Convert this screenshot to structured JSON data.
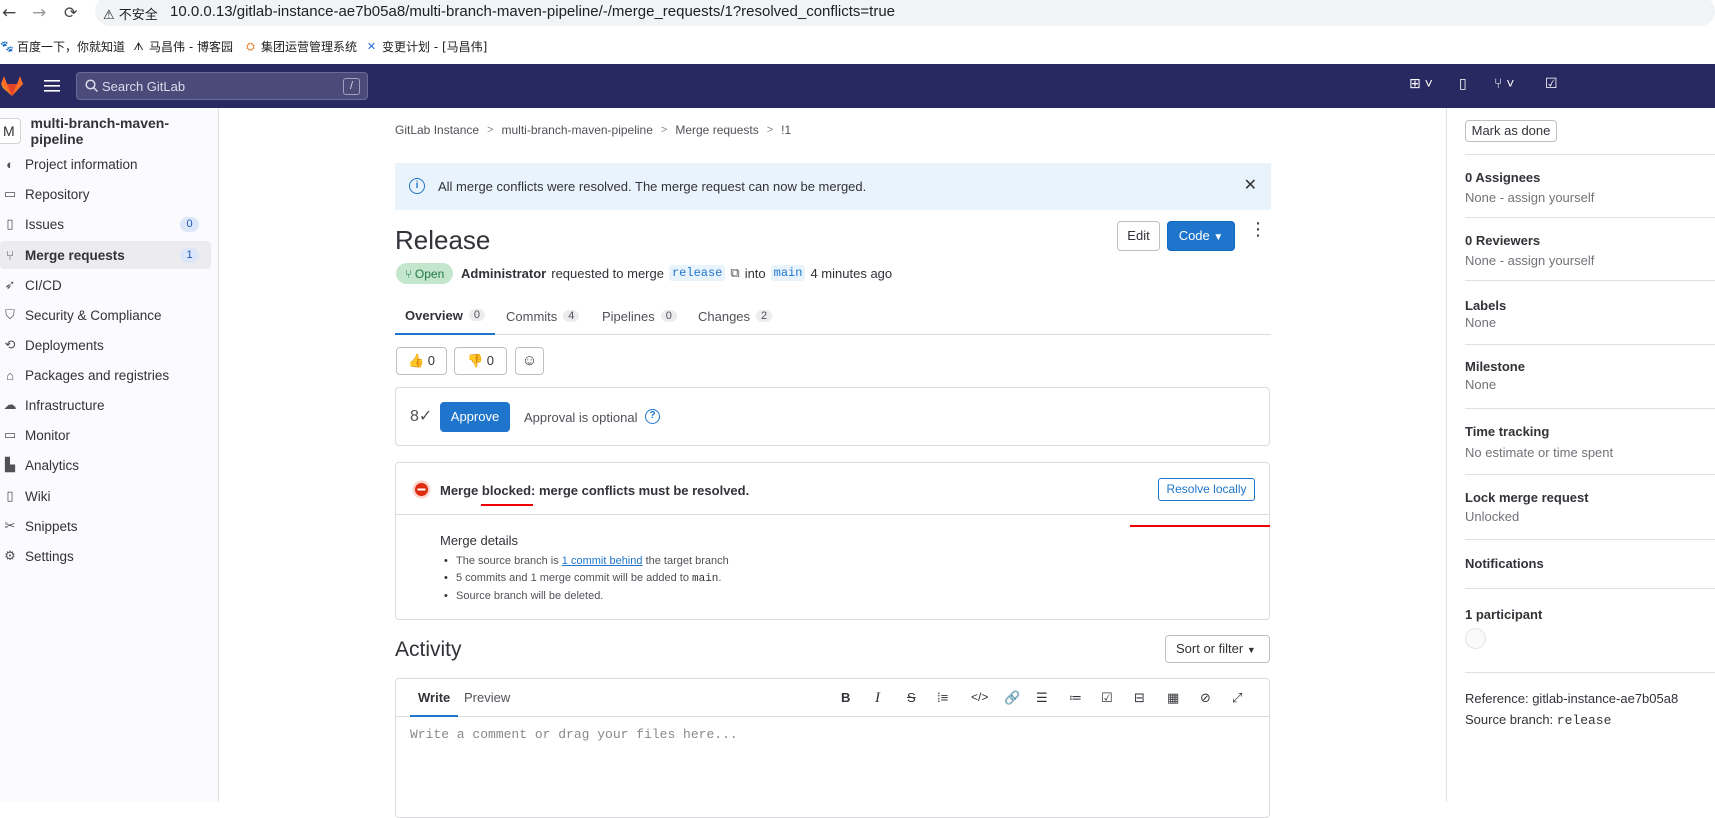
{
  "browser": {
    "back": "←",
    "forward": "→",
    "reload": "C",
    "insecure_label": "不安全",
    "url": "10.0.0.13/gitlab-instance-ae7b05a8/multi-branch-maven-pipeline/-/merge_requests/1?resolved_conflicts=true",
    "bookmarks": [
      "百度一下，你就知道",
      "马昌伟 - 博客园",
      "集团运营管理系统",
      "变更计划 - [马昌伟]"
    ]
  },
  "header": {
    "search_placeholder": "Search GitLab",
    "search_shortcut": "/"
  },
  "sidebar": {
    "project_avatar": "M",
    "project_name": "multi-branch-maven-pipeline",
    "items": [
      {
        "label": "Project information",
        "icon": "info-icon"
      },
      {
        "label": "Repository",
        "icon": "doc-icon"
      },
      {
        "label": "Issues",
        "icon": "issues-icon",
        "count": "0"
      },
      {
        "label": "Merge requests",
        "icon": "merge-request-icon",
        "count": "1"
      },
      {
        "label": "CI/CD",
        "icon": "rocket-icon"
      },
      {
        "label": "Security & Compliance",
        "icon": "shield-icon"
      },
      {
        "label": "Deployments",
        "icon": "deployments-icon"
      },
      {
        "label": "Packages and registries",
        "icon": "package-icon"
      },
      {
        "label": "Infrastructure",
        "icon": "cloud-icon"
      },
      {
        "label": "Monitor",
        "icon": "monitor-icon"
      },
      {
        "label": "Analytics",
        "icon": "chart-icon"
      },
      {
        "label": "Wiki",
        "icon": "book-icon"
      },
      {
        "label": "Snippets",
        "icon": "scissors-icon"
      },
      {
        "label": "Settings",
        "icon": "gear-icon"
      }
    ]
  },
  "breadcrumbs": [
    "GitLab Instance",
    "multi-branch-maven-pipeline",
    "Merge requests",
    "!1"
  ],
  "alert": {
    "text": "All merge conflicts were resolved. The merge request can now be merged."
  },
  "mr": {
    "title": "Release",
    "edit_label": "Edit",
    "code_label": "Code",
    "status": "Open",
    "author": "Administrator",
    "requested_text": "requested to merge",
    "source_branch": "release",
    "into_text": "into",
    "target_branch": "main",
    "time": "4 minutes ago"
  },
  "tabs": [
    {
      "label": "Overview",
      "count": "0"
    },
    {
      "label": "Commits",
      "count": "4"
    },
    {
      "label": "Pipelines",
      "count": "0"
    },
    {
      "label": "Changes",
      "count": "2"
    }
  ],
  "reactions": {
    "thumbs_up": "0",
    "thumbs_down": "0"
  },
  "approval": {
    "button": "Approve",
    "text": "Approval is optional"
  },
  "merge": {
    "blocked_text": "Merge blocked: merge conflicts must be resolved.",
    "resolve_button": "Resolve locally",
    "details_title": "Merge details",
    "detail1_pre": "The source branch is",
    "detail1_link": "1 commit behind",
    "detail1_post": "the target branch",
    "detail2_pre": "5 commits and 1 merge commit will be added to",
    "detail2_code": "main",
    "detail2_post": ".",
    "detail3": "Source branch will be deleted."
  },
  "activity": {
    "title": "Activity",
    "sort_label": "Sort or filter",
    "write_tab": "Write",
    "preview_tab": "Preview",
    "comment_placeholder": "Write a comment or drag your files here..."
  },
  "right_sidebar": {
    "mark_done": "Mark as done",
    "assignees_title": "0 Assignees",
    "assignees_value": "None - assign yourself",
    "reviewers_title": "0 Reviewers",
    "reviewers_value": "None - assign yourself",
    "labels_title": "Labels",
    "labels_value": "None",
    "milestone_title": "Milestone",
    "milestone_value": "None",
    "time_title": "Time tracking",
    "time_value": "No estimate or time spent",
    "lock_title": "Lock merge request",
    "lock_value": "Unlocked",
    "notifications_title": "Notifications",
    "participants_title": "1 participant",
    "reference_label": "Reference: gitlab-instance-ae7b05a8",
    "source_branch_label": "Source branch:",
    "source_branch_value": "release"
  },
  "colors": {
    "header_bg": "#292961",
    "primary": "#1f75cb",
    "alert_bg": "#e9f3fc",
    "danger": "#dd2b0e",
    "open_badge": "#c3e6cd"
  }
}
